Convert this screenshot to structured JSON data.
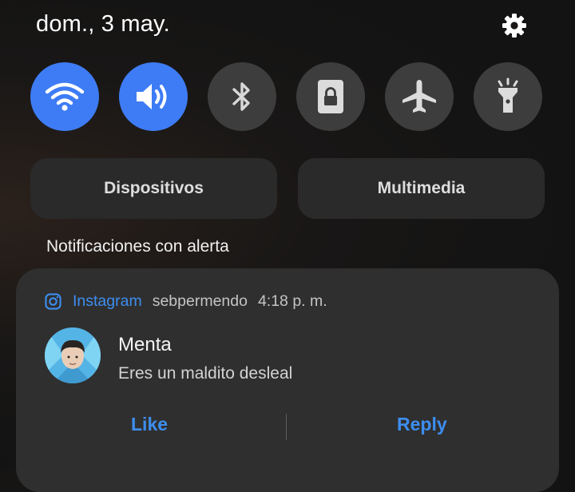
{
  "status": {
    "date": "dom., 3 may."
  },
  "header": {
    "settings_icon": "gear-icon"
  },
  "quick_settings": [
    {
      "name": "wifi",
      "icon": "wifi-icon",
      "active": true
    },
    {
      "name": "sound",
      "icon": "volume-icon",
      "active": true
    },
    {
      "name": "bluetooth",
      "icon": "bluetooth-icon",
      "active": false
    },
    {
      "name": "rotation-lock",
      "icon": "lock-icon",
      "active": false
    },
    {
      "name": "airplane",
      "icon": "airplane-icon",
      "active": false
    },
    {
      "name": "flashlight",
      "icon": "flashlight-icon",
      "active": false
    }
  ],
  "panels": {
    "devices_label": "Dispositivos",
    "media_label": "Multimedia"
  },
  "section": {
    "title": "Notificaciones con alerta"
  },
  "notification": {
    "app": "Instagram",
    "sender": "sebpermendo",
    "time": "4:18 p. m.",
    "title": "Menta",
    "body": "Eres un maldito desleal",
    "actions": {
      "like": "Like",
      "reply": "Reply"
    }
  },
  "colors": {
    "accent": "#3e7cf5",
    "link": "#3d8ef0",
    "tile_off": "#3d3d3d",
    "card": "#2f2f2f"
  }
}
